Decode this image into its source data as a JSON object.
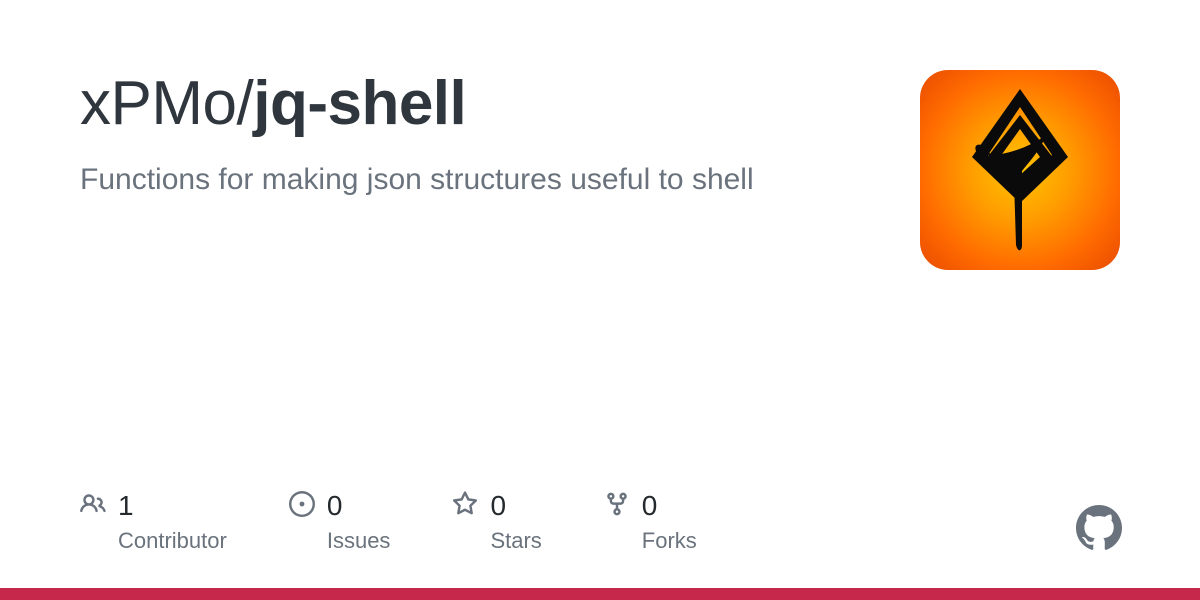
{
  "repo": {
    "owner": "xPMo",
    "name": "jq-shell",
    "description": "Functions for making json structures useful to shell"
  },
  "stats": {
    "contributors": {
      "count": "1",
      "label": "Contributor"
    },
    "issues": {
      "count": "0",
      "label": "Issues"
    },
    "stars": {
      "count": "0",
      "label": "Stars"
    },
    "forks": {
      "count": "0",
      "label": "Forks"
    }
  },
  "colors": {
    "accent_bar": "#c6284b"
  }
}
